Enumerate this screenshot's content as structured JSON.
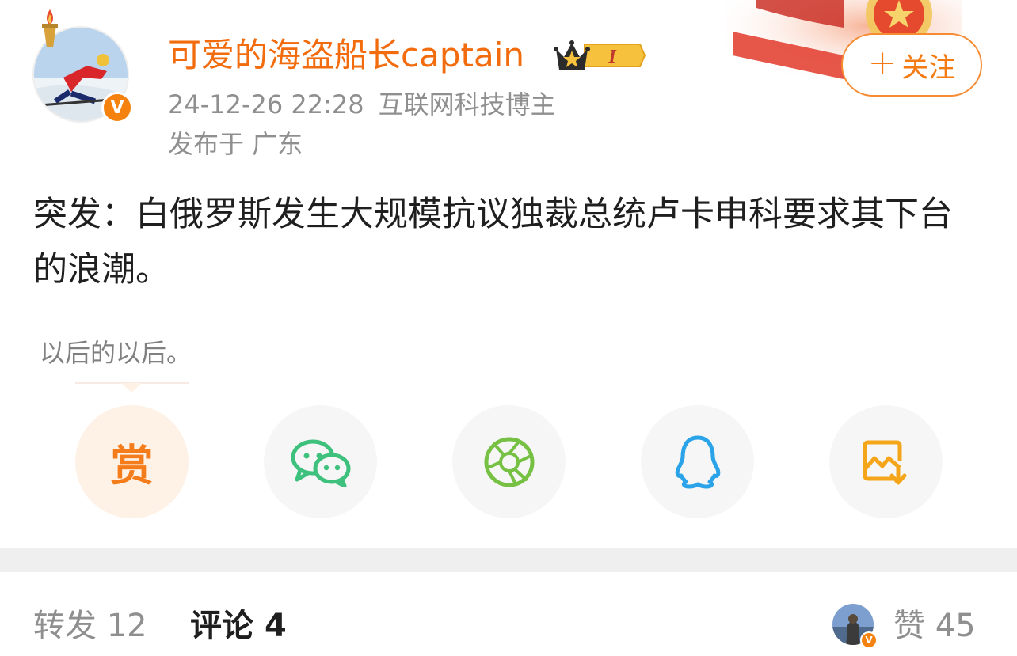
{
  "author": {
    "name": "可爱的海盗船长captain",
    "timestamp": "24-12-26 22:28",
    "role": "互联网科技博主",
    "location": "发布于 广东",
    "verified_mark": "V"
  },
  "badge": {
    "level_label": "I"
  },
  "follow_button": {
    "plus": "+",
    "label": "关注"
  },
  "post": {
    "text": "突发：白俄罗斯发生大规模抗议独裁总统卢卡申科要求其下台的浪潮。",
    "caption": "以后的以后。"
  },
  "share_bar": {
    "reward_label": "赏",
    "items": [
      "reward-icon",
      "wechat-icon",
      "moments-icon",
      "qq-icon",
      "save-image-icon"
    ]
  },
  "stats": {
    "repost_label": "转发",
    "repost_count": "12",
    "comment_label": "评论",
    "comment_count": "4",
    "like_label": "赞",
    "like_count": "45"
  },
  "colors": {
    "accent": "#f26c0e",
    "follow_border": "#f68b32",
    "meta_gray": "#8f8f8f",
    "wechat_green": "#3ec17c",
    "moments_green": "#76c043",
    "qq_blue": "#2aa3e8",
    "save_orange": "#f5a51a"
  }
}
